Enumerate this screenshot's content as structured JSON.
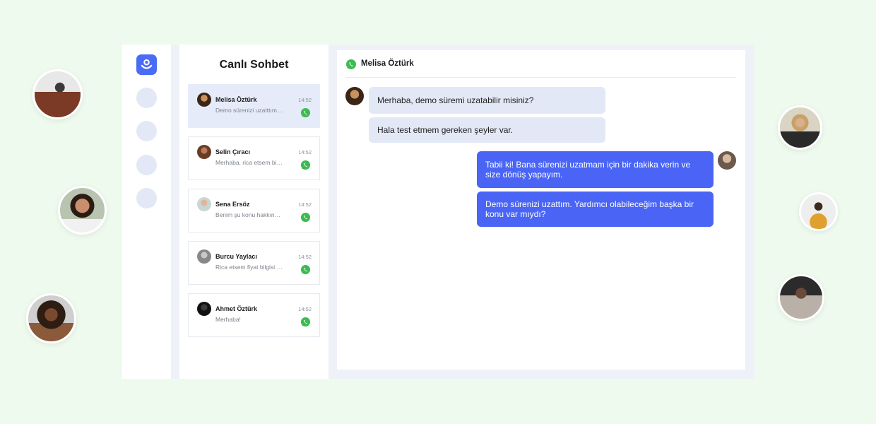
{
  "list": {
    "title": "Canlı Sohbet",
    "conversations": [
      {
        "name": "Melisa Öztürk",
        "time": "14:52",
        "preview": "Demo sürenizi uzatttım. Yardımcı olabileceğim başka bir konu var mıydı?"
      },
      {
        "name": "Selin Çıracı",
        "time": "14:52",
        "preview": "Merhaba, rica etsem bilgi alabilir miyim?"
      },
      {
        "name": "Sena Ersöz",
        "time": "14:52",
        "preview": "Benim şu konu hakkında sorum var"
      },
      {
        "name": "Burcu Yaylacı",
        "time": "14:52",
        "preview": "Rica etsem fiyat bilgisi verebilir misiniz?"
      },
      {
        "name": "Ahmet  Öztürk",
        "time": "14:52",
        "preview": "Merhaba!"
      }
    ]
  },
  "chat": {
    "contact_name": "Melisa Öztürk",
    "messages": [
      {
        "direction": "in",
        "text": "Merhaba, demo süremi uzatabilir misiniz?"
      },
      {
        "direction": "in",
        "text": "Hala test etmem gereken şeyler var."
      },
      {
        "direction": "out",
        "text": "Tabii ki! Bana sürenizi uzatmam için bir dakika verin ve size dönüş yapayım."
      },
      {
        "direction": "out",
        "text": "Demo sürenizi uzattım. Yardımcı olabileceğim başka bir konu var mıydı?"
      }
    ]
  },
  "colors": {
    "accent": "#4a65f5",
    "incoming_bubble": "#e3e8f6",
    "whatsapp": "#3dbb52",
    "page_background": "#effaee"
  },
  "icons": {
    "logo": "brand-logo-icon",
    "channel": "whatsapp-icon"
  }
}
